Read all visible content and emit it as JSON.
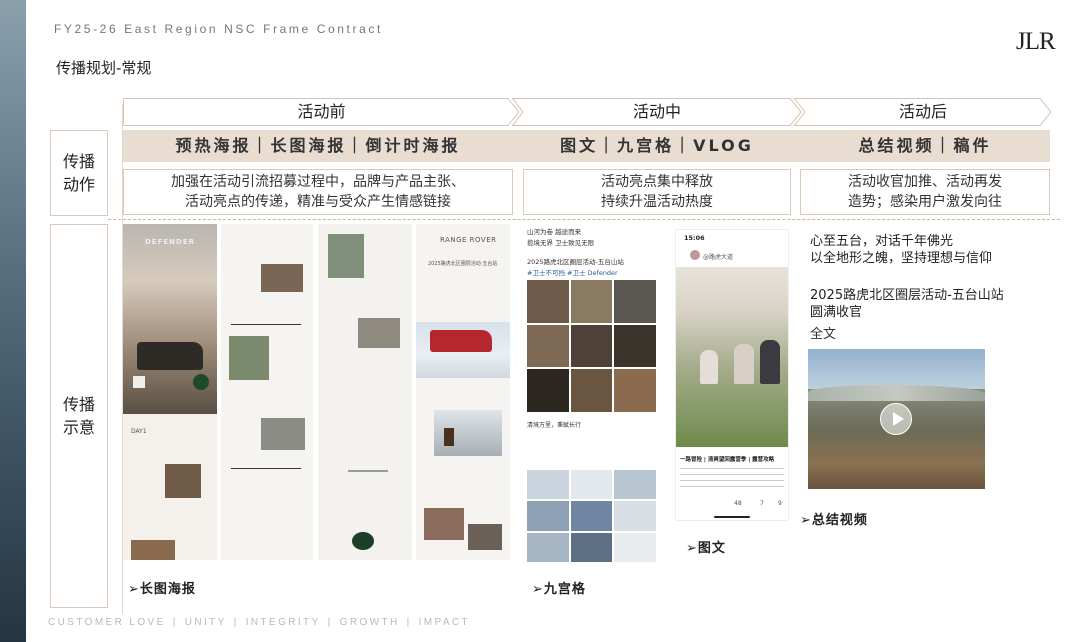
{
  "header": {
    "doc_title": "FY25-26 East Region NSC Frame Contract",
    "section_title": "传播规划-常规",
    "logo": "JLR"
  },
  "phases": [
    "活动前",
    "活动中",
    "活动后"
  ],
  "rows": {
    "label_1": [
      "传播",
      "动作"
    ],
    "label_2": [
      "传播",
      "示意"
    ]
  },
  "tags": [
    "预热海报｜长图海报｜倒计时海报",
    "图文｜九宫格｜VLOG",
    "总结视频｜稿件"
  ],
  "descriptions": [
    [
      "加强在活动引流招募过程中，品牌与产品主张、",
      "活动亮点的传递，精准与受众产生情感链接"
    ],
    [
      "活动亮点集中释放",
      "持续升温活动热度"
    ],
    [
      "活动收官加推、活动再发",
      "造势；感染用户激发向往"
    ]
  ],
  "examples": {
    "poster_brand_1": "DEFENDER",
    "poster_brand_2": "RANGE ROVER",
    "poster_title": "2025路虎北区圈层活动·五台站",
    "poster_day": "DAY1",
    "grid_post": {
      "line1": "山河为卷 越途而来",
      "line2": "揽境无界 卫士致见无限",
      "line3": "2025路虎北区圈层活动-五台山站",
      "line4": "#卫士不可挡 #卫士 Defender",
      "line5": "清境万里，秉赋长行"
    },
    "phone": {
      "time": "15:06",
      "account": "@路虎大道",
      "caption": "一路冒险 | 清爽望回露营季 | 露营攻略",
      "likes": "48",
      "shares": "7",
      "comments": "9"
    },
    "summary": {
      "line1": "心至五台，对话千年佛光",
      "line2": "以全地形之魄，坚持理想与信仰",
      "line3": "2025路虎北区圈层活动-五台山站",
      "line4": "圆满收官",
      "link": "全文"
    }
  },
  "captions": [
    "长图海报",
    "九宫格",
    "图文",
    "总结视频"
  ],
  "footer": [
    "CUSTOMER LOVE",
    "|",
    "UNITY",
    "|",
    "INTEGRITY",
    "|",
    "GROWTH",
    "|",
    "IMPACT"
  ]
}
